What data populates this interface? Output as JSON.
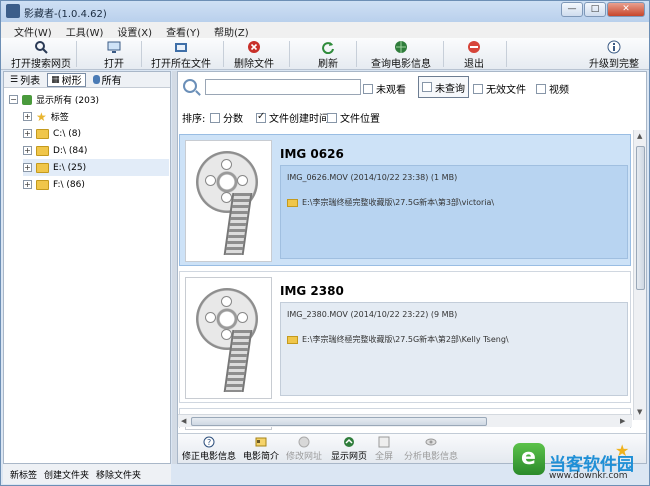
{
  "window": {
    "title": "影藏者-(1.0.4.62)"
  },
  "menu": [
    "文件(W)",
    "工具(W)",
    "设置(X)",
    "查看(Y)",
    "帮助(Z)"
  ],
  "toolbar": {
    "open_web": "打开搜索网页",
    "open": "打开",
    "open_folder": "打开所在文件夹",
    "delete": "删除文件",
    "refresh": "刷新",
    "query_info": "查询电影信息",
    "exit": "退出",
    "upgrade": "升级到完整版"
  },
  "left": {
    "tabs": [
      "列表",
      "树形",
      "所有"
    ],
    "root": "显示所有 (203)",
    "items": [
      "标签",
      "C:\\ (8)",
      "D:\\ (84)",
      "E:\\ (25)",
      "F:\\ (86)"
    ],
    "bottom": [
      "新标签",
      "创建文件夹",
      "移除文件夹"
    ]
  },
  "filters": {
    "search_placeholder": "",
    "unwatched": "未观看",
    "unqueried": "未查询",
    "invalid": "无效文件",
    "video": "视频"
  },
  "sort": {
    "label": "排序:",
    "score": "分数",
    "created": "文件创建时间",
    "location": "文件位置"
  },
  "files": [
    {
      "title": "IMG 0626",
      "meta": "IMG_0626.MOV (2014/10/22 23:38) (1 MB)",
      "path": "E:\\李宗瑞终極完整收藏版\\27.5G新本\\第3部\\victoria\\"
    },
    {
      "title": "IMG 2380",
      "meta": "IMG_2380.MOV (2014/10/22 23:22) (9 MB)",
      "path": "E:\\李宗瑞终極完整收藏版\\27.5G新本\\第2部\\Kelly Tseng\\"
    }
  ],
  "bottombar": {
    "fix_info": "修正电影信息",
    "intro": "电影简介",
    "edit_url": "修改网址",
    "show_web": "显示网页",
    "fullscreen": "全屏",
    "analyze": "分析电影信息"
  },
  "watermark": {
    "title": "当客软件园",
    "url": "www.downkr.com"
  },
  "colors": {
    "selected_card": "#cde2f7",
    "accent": "#1f8fd6"
  }
}
